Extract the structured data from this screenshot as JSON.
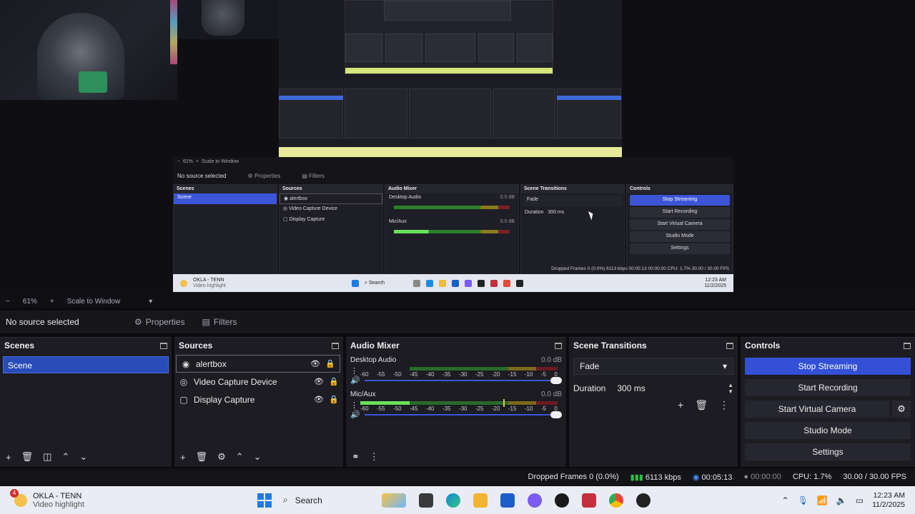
{
  "preview": {
    "mid_scale_zoom": "61%",
    "mid_scale_mode": "Scale to Window",
    "mid_no_source": "No source selected",
    "mid_properties": "Properties",
    "mid_filters": "Filters",
    "mid_scenes": "Scenes",
    "mid_scene": "Scene",
    "mid_sources": "Sources",
    "mid_src1": "alertbox",
    "mid_src2": "Video Capture Device",
    "mid_src3": "Display Capture",
    "mid_audio_mixer": "Audio Mixer",
    "mid_desktop_audio": "Desktop Audio",
    "mid_mic": "Mic/Aux",
    "mid_db1": "0.0 dB",
    "mid_db2": "0.0 dB",
    "mid_scene_transitions": "Scene Transitions",
    "mid_fade": "Fade",
    "mid_duration": "Duration",
    "mid_duration_value": "300 ms",
    "mid_controls": "Controls",
    "mid_stop_streaming": "Stop Streaming",
    "mid_start_recording": "Start Recording",
    "mid_start_virtual_camera": "Start Virtual Camera",
    "mid_studio_mode": "Studio Mode",
    "mid_settings": "Settings",
    "mid_status": "Dropped Frames 0 (0.0%)   6113 kbps   00:05:13   00:00:00   CPU: 1.7%   30.00 / 30.00 FPS",
    "mid_news_title": "OKLA - TENN",
    "mid_news_sub": "Video highlight",
    "mid_search": "Search",
    "mid_time": "12:23 AM",
    "mid_date": "11/2/2025"
  },
  "canvas_toolbar": {
    "zoom": "61%",
    "scale_mode": "Scale to Window"
  },
  "context_bar": {
    "no_source": "No source selected",
    "properties": "Properties",
    "filters": "Filters"
  },
  "scenes": {
    "title": "Scenes",
    "items": [
      "Scene"
    ]
  },
  "sources": {
    "title": "Sources",
    "items": [
      {
        "name": "alertbox",
        "icon": "globe-icon"
      },
      {
        "name": "Video Capture Device",
        "icon": "camera-icon"
      },
      {
        "name": "Display Capture",
        "icon": "monitor-icon"
      }
    ]
  },
  "audio_mixer": {
    "title": "Audio Mixer",
    "channels": [
      {
        "name": "Desktop Audio",
        "db": "0.0 dB",
        "level": 0.0
      },
      {
        "name": "Mic/Aux",
        "db": "0.0 dB",
        "level": 0.27
      }
    ],
    "ticks": [
      "-60",
      "-55",
      "-50",
      "-45",
      "-40",
      "-35",
      "-30",
      "-25",
      "-20",
      "-15",
      "-10",
      "-5",
      "0"
    ]
  },
  "scene_transitions": {
    "title": "Scene Transitions",
    "transition": "Fade",
    "duration_label": "Duration",
    "duration_value": "300 ms"
  },
  "controls": {
    "title": "Controls",
    "stop_streaming": "Stop Streaming",
    "start_recording": "Start Recording",
    "start_virtual_camera": "Start Virtual Camera",
    "studio_mode": "Studio Mode",
    "settings": "Settings"
  },
  "status": {
    "dropped_frames": "Dropped Frames 0 (0.0%)",
    "bitrate": "6113 kbps",
    "stream_time": "00:05:13",
    "record_time": "00:00:00",
    "cpu": "CPU: 1.7%",
    "fps": "30.00 / 30.00 FPS"
  },
  "taskbar": {
    "news_badge": "4",
    "news_title": "OKLA - TENN",
    "news_subtitle": "Video highlight",
    "search": "Search",
    "time": "12:23 AM",
    "date": "11/2/2025"
  },
  "colors": {
    "accent": "#3350d6",
    "live_green": "#2fbf4a",
    "dock_bg": "#1c1c22"
  }
}
